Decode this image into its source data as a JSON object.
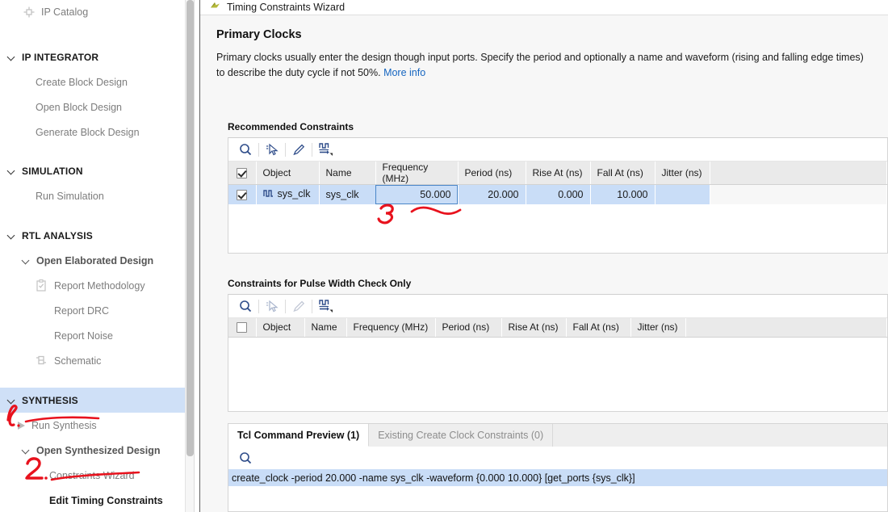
{
  "sidebar": {
    "items": [
      {
        "label": "IP Catalog",
        "type": "leaf",
        "icon": "chip-icon",
        "indent": 28
      },
      {
        "label": "IP INTEGRATOR",
        "type": "section",
        "indent": 8
      },
      {
        "label": "Create Block Design",
        "type": "leaf",
        "indent": 44
      },
      {
        "label": "Open Block Design",
        "type": "leaf",
        "indent": 44
      },
      {
        "label": "Generate Block Design",
        "type": "leaf",
        "indent": 44
      },
      {
        "label": "SIMULATION",
        "type": "section",
        "indent": 8
      },
      {
        "label": "Run Simulation",
        "type": "leaf",
        "indent": 44
      },
      {
        "label": "RTL ANALYSIS",
        "type": "section",
        "indent": 8
      },
      {
        "label": "Open Elaborated Design",
        "type": "sub",
        "indent": 26
      },
      {
        "label": "Report Methodology",
        "type": "leaf",
        "icon": "clipboard-check-icon",
        "indent": 44
      },
      {
        "label": "Report DRC",
        "type": "leaf",
        "indent": 66
      },
      {
        "label": "Report Noise",
        "type": "leaf",
        "indent": 66
      },
      {
        "label": "Schematic",
        "type": "leaf",
        "icon": "schematic-icon",
        "indent": 44
      },
      {
        "label": "SYNTHESIS",
        "type": "section",
        "selected": true,
        "indent": 8
      },
      {
        "label": "Run Synthesis",
        "type": "run",
        "indent": 22
      },
      {
        "label": "Open Synthesized Design",
        "type": "sub",
        "indent": 26
      },
      {
        "label": "Constraints Wizard",
        "type": "leaf",
        "indent": 60
      },
      {
        "label": "Edit Timing Constraints",
        "type": "leafdark",
        "indent": 60
      }
    ]
  },
  "wizard": {
    "title": "Timing Constraints Wizard",
    "page_title": "Primary Clocks",
    "description_part1": "Primary clocks usually enter the design though input ports. Specify the period and optionally a name and waveform (rising and falling edge times) to describe the duty cycle if not 50%. ",
    "more_info_link": "More info"
  },
  "recommended": {
    "section_label": "Recommended Constraints",
    "toolbar": [
      "search-icon",
      "select-cursor-icon",
      "edit-pencil-icon",
      "waveform-apply-icon"
    ],
    "columns": [
      "Object",
      "Name",
      "Frequency (MHz)",
      "Period (ns)",
      "Rise At (ns)",
      "Fall At (ns)",
      "Jitter (ns)"
    ],
    "header_checkbox_checked": true,
    "rows": [
      {
        "checked": true,
        "object": "sys_clk",
        "object_icon": "clock-waveform-icon",
        "name": "sys_clk",
        "frequency": "50.000",
        "period": "20.000",
        "rise_at": "0.000",
        "fall_at": "10.000",
        "jitter": "",
        "selected": true,
        "focused_cell": "frequency"
      }
    ]
  },
  "pulse_width": {
    "section_label": "Constraints for Pulse Width Check Only",
    "toolbar": [
      "search-icon",
      "select-cursor-icon",
      "edit-pencil-icon",
      "waveform-apply-icon"
    ],
    "columns": [
      "Object",
      "Name",
      "Frequency (MHz)",
      "Period (ns)",
      "Rise At (ns)",
      "Fall At (ns)",
      "Jitter (ns)"
    ],
    "header_checkbox_checked": false,
    "rows": []
  },
  "bottom": {
    "tabs": [
      {
        "label": "Tcl Command Preview (1)",
        "active": true
      },
      {
        "label": "Existing Create Clock Constraints (0)",
        "active": false
      }
    ],
    "toolbar": [
      "search-icon"
    ],
    "command_rows": [
      "create_clock -period 20.000 -name sys_clk -waveform {0.000 10.000} [get_ports {sys_clk}]"
    ]
  },
  "annotations": [
    {
      "text": "1.",
      "target": "Run Synthesis"
    },
    {
      "text": "2.",
      "target": "Constraints Wizard"
    },
    {
      "text": "3",
      "target": "Frequency (MHz) value"
    }
  ],
  "colors": {
    "selection_blue": "#c9ddf7",
    "sidebar_selection": "#cfe0f7",
    "link_blue": "#1565c0",
    "icon_blue": "#2f4d8a",
    "annotation_red": "#e8121d",
    "header_grey": "#eaeaea",
    "panel_bg": "#f7f7f7"
  }
}
